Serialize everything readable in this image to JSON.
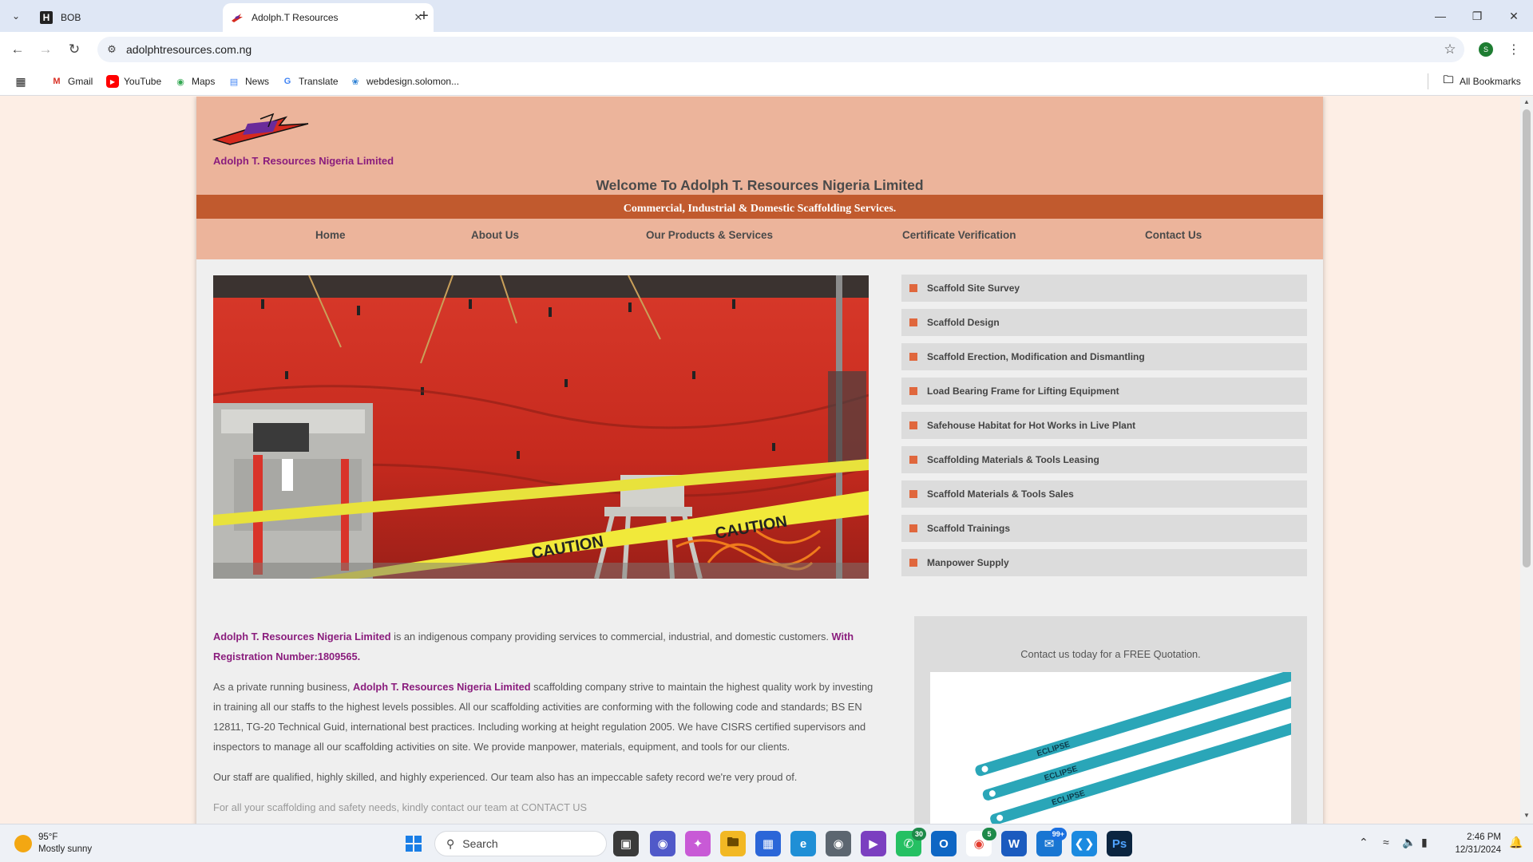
{
  "browser": {
    "tabs": [
      {
        "title": "BOB",
        "favicon": "H",
        "active": false
      },
      {
        "title": "Adolph.T Resources",
        "favicon": "logo",
        "active": true
      }
    ],
    "url": "adolphtresources.com.ng",
    "profile_initial": "S",
    "bookmarks": [
      {
        "label": "Gmail",
        "icon": "gmail-icon"
      },
      {
        "label": "YouTube",
        "icon": "youtube-icon"
      },
      {
        "label": "Maps",
        "icon": "maps-icon"
      },
      {
        "label": "News",
        "icon": "news-icon"
      },
      {
        "label": "Translate",
        "icon": "translate-icon"
      },
      {
        "label": "webdesign.solomon...",
        "icon": "webdesign-icon"
      }
    ],
    "all_bookmarks_label": "All Bookmarks"
  },
  "site": {
    "company_name": "Adolph T. Resources Nigeria Limited",
    "welcome": "Welcome To Adolph T. Resources Nigeria Limited",
    "tagline": "Commercial, Industrial & Domestic Scaffolding Services.",
    "nav": [
      "Home",
      "About Us",
      "Our Products & Services",
      "Certificate Verification",
      "Contact Us"
    ],
    "services": [
      "Scaffold Site Survey",
      "Scaffold Design",
      "Scaffold Erection, Modification and Dismantling",
      "Load Bearing Frame for Lifting Equipment",
      "Safehouse Habitat for Hot Works in Live Plant",
      "Scaffolding Materials & Tools Leasing",
      "Scaffold Materials & Tools Sales",
      "Scaffold Trainings",
      "Manpower Supply"
    ],
    "about": {
      "p1_company": "Adolph T. Resources Nigeria Limited",
      "p1_text": " is an indigenous company providing services to commercial, industrial, and domestic customers. ",
      "p1_reg": "With Registration Number:1809565.",
      "p2_prefix": "As a private running business, ",
      "p2_company": "Adolph T. Resources Nigeria Limited",
      "p2_text": " scaffolding company strive to maintain the highest quality work by investing in training all our staffs to the highest levels possibles. All our scaffolding activities are conforming with the following code and standards; BS EN 12811, TG-20 Technical Guid, international best practices. Including working at height regulation 2005. We have CISRS certified supervisors and inspectors to manage all our scaffolding activities on site. We provide manpower, materials, equipment, and tools for our clients.",
      "p3": "Our staff are qualified, highly skilled, and highly experienced. Our team also has an impeccable safety record we're very proud of.",
      "p4_partial": "For all your scaffolding and safety needs, kindly contact our team at CONTACT US"
    },
    "quote_text": "Contact us today for a FREE Quotation.",
    "hero_caution_text": "CAUTION",
    "blade_brand": "ECLIPSE"
  },
  "taskbar": {
    "weather_temp": "95°F",
    "weather_desc": "Mostly sunny",
    "search_placeholder": "Search",
    "whatsapp_badge": "30",
    "chrome_badge": "5",
    "mail_badge": "99+",
    "time": "2:46 PM",
    "date": "12/31/2024"
  },
  "colors": {
    "header_bg": "#ecb49b",
    "tagline_bg": "#c15a2e",
    "brand_purple": "#8a1d7d",
    "bullet": "#e0673d"
  }
}
